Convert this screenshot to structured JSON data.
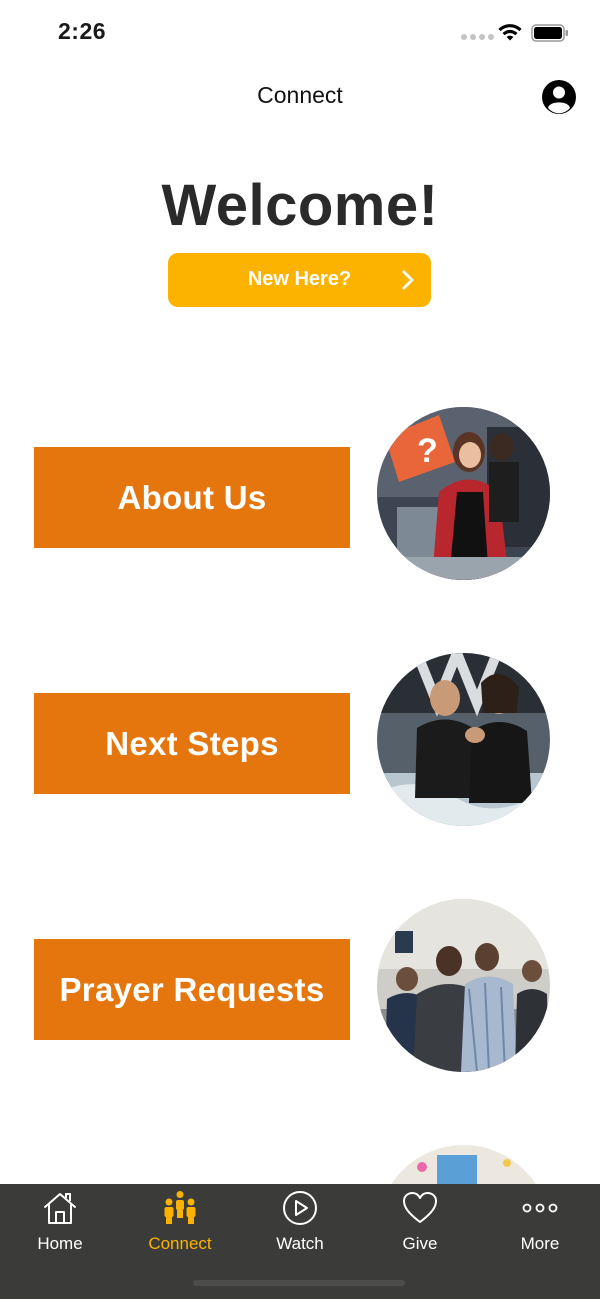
{
  "status_bar": {
    "time": "2:26",
    "wifi_icon": "wifi-icon",
    "battery_icon": "battery-icon"
  },
  "header": {
    "title": "Connect",
    "profile_icon": "profile-icon"
  },
  "welcome": {
    "title": "Welcome!",
    "new_here_label": "New Here?",
    "new_here_icon": "chevron-right-icon"
  },
  "menu": {
    "items": [
      {
        "label": "About Us",
        "photo": "about-us-photo"
      },
      {
        "label": "Next Steps",
        "photo": "next-steps-photo"
      },
      {
        "label": "Prayer Requests",
        "photo": "prayer-requests-photo"
      }
    ]
  },
  "tab_bar": {
    "tabs": [
      {
        "label": "Home",
        "icon": "home-icon",
        "active": false
      },
      {
        "label": "Connect",
        "icon": "people-icon",
        "active": true
      },
      {
        "label": "Watch",
        "icon": "play-circle-icon",
        "active": false
      },
      {
        "label": "Give",
        "icon": "heart-icon",
        "active": false
      },
      {
        "label": "More",
        "icon": "more-dots-icon",
        "active": false
      }
    ]
  },
  "colors": {
    "accent_yellow": "#fbb300",
    "button_orange": "#e5760e",
    "tab_bar_bg": "#3b3b39",
    "text_dark": "#2a2a2a"
  }
}
